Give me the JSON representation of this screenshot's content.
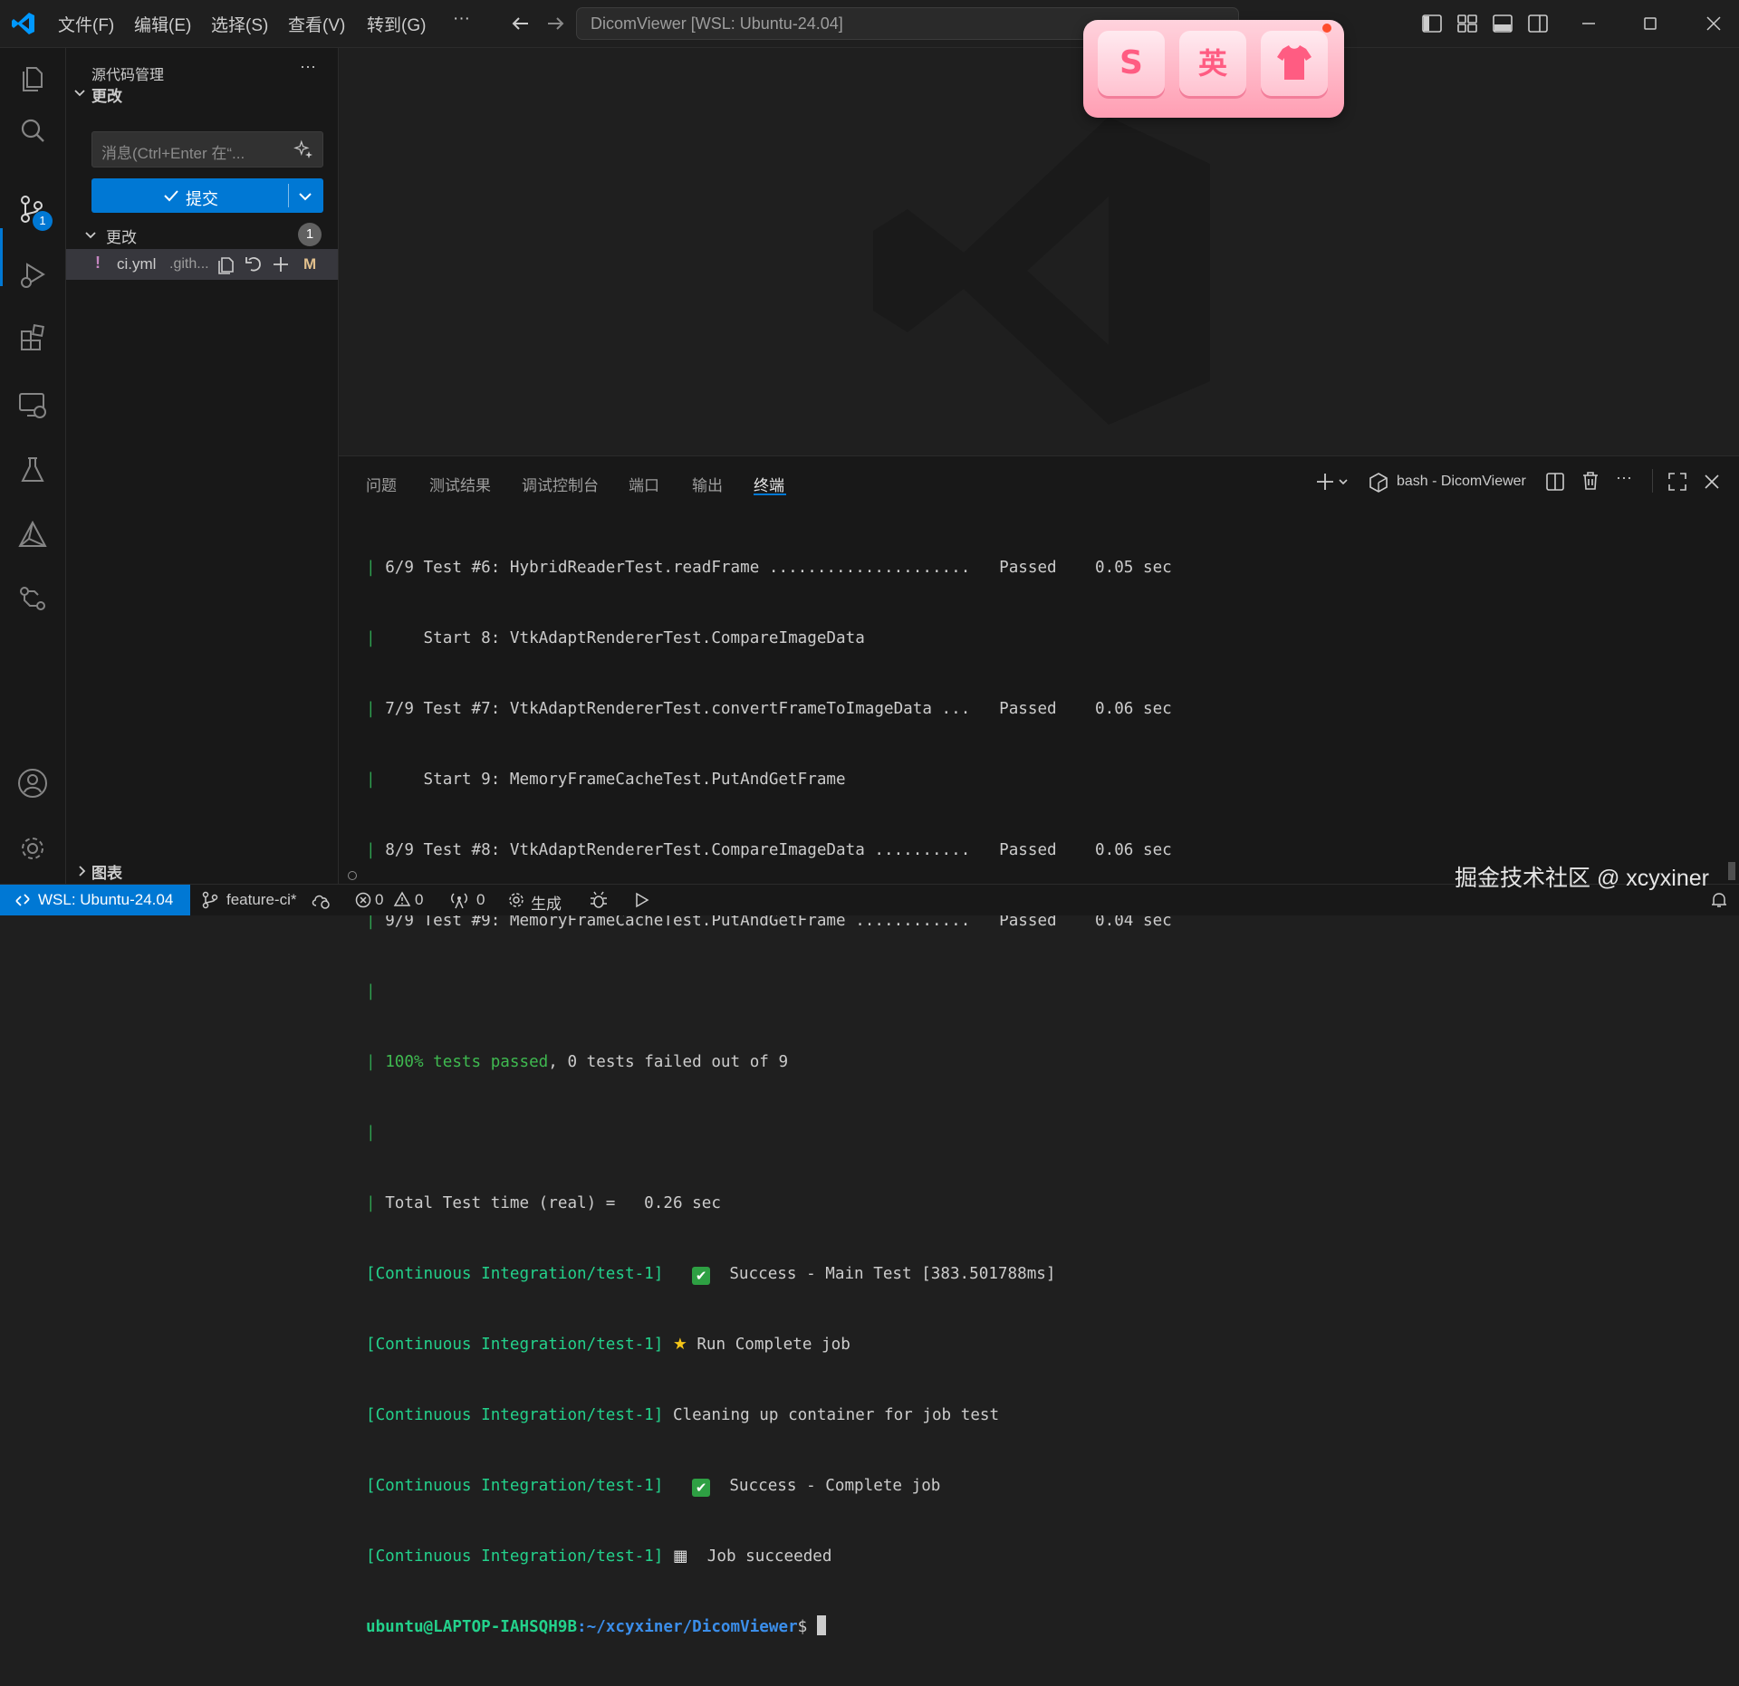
{
  "titlebar": {
    "menus": [
      "文件(F)",
      "编辑(E)",
      "选择(S)",
      "查看(V)",
      "转到(G)",
      "···"
    ],
    "command_center": "DicomViewer [WSL: Ubuntu-24.04]"
  },
  "activity": {
    "scm_badge": "1"
  },
  "sidebar": {
    "title": "源代码管理",
    "more": "···",
    "section_label": "更改",
    "message_placeholder": "消息(Ctrl+Enter 在“...",
    "commit_label": "提交",
    "changes_label": "更改",
    "changes_count": "1",
    "file": {
      "name": "ci.yml",
      "path": ".gith...",
      "status": "M",
      "prefix": "!"
    },
    "graph_label": "图表"
  },
  "panel": {
    "tabs": [
      "问题",
      "测试结果",
      "调试控制台",
      "端口",
      "输出",
      "终端"
    ],
    "active_tab": "终端",
    "terminal_name": "bash - DicomViewer",
    "lines": [
      "6/9 Test #6: HybridReaderTest.readFrame .....................   Passed    0.05 sec",
      "    Start 8: VtkAdaptRendererTest.CompareImageData",
      "7/9 Test #7: VtkAdaptRendererTest.convertFrameToImageData ...   Passed    0.06 sec",
      "    Start 9: MemoryFrameCacheTest.PutAndGetFrame",
      "8/9 Test #8: VtkAdaptRendererTest.CompareImageData ..........   Passed    0.06 sec",
      "9/9 Test #9: MemoryFrameCacheTest.PutAndGetFrame ............   Passed    0.04 sec",
      "",
      "",
      "",
      "Total Test time (real) =   0.26 sec"
    ],
    "passed_green": "100% tests passed",
    "passed_rest": ", 0 tests failed out of 9",
    "ci_tag": "[Continuous Integration/test-1]",
    "ci_lines": [
      {
        "icon": "check",
        "text": "  Success - Main Test [383.501788ms]"
      },
      {
        "icon": "star",
        "text": " Run Complete job"
      },
      {
        "icon": "",
        "text": "Cleaning up container for job test"
      },
      {
        "icon": "check",
        "text": "  Success - Complete job"
      },
      {
        "icon": "flag",
        "text": "  Job succeeded"
      }
    ],
    "prompt_user": "ubuntu@LAPTOP-IAHSQH9B",
    "prompt_path": ":~/xcyxiner/DicomViewer",
    "prompt_end": "$ "
  },
  "statusbar": {
    "remote": "WSL: Ubuntu-24.04",
    "branch": "feature-ci*",
    "errors": "0",
    "warnings": "0",
    "ports": "0",
    "build": "生成"
  },
  "overlay": {
    "keys": [
      "S",
      "英",
      "👕"
    ]
  },
  "watermark": "掘金技术社区 @ xcyxiner"
}
